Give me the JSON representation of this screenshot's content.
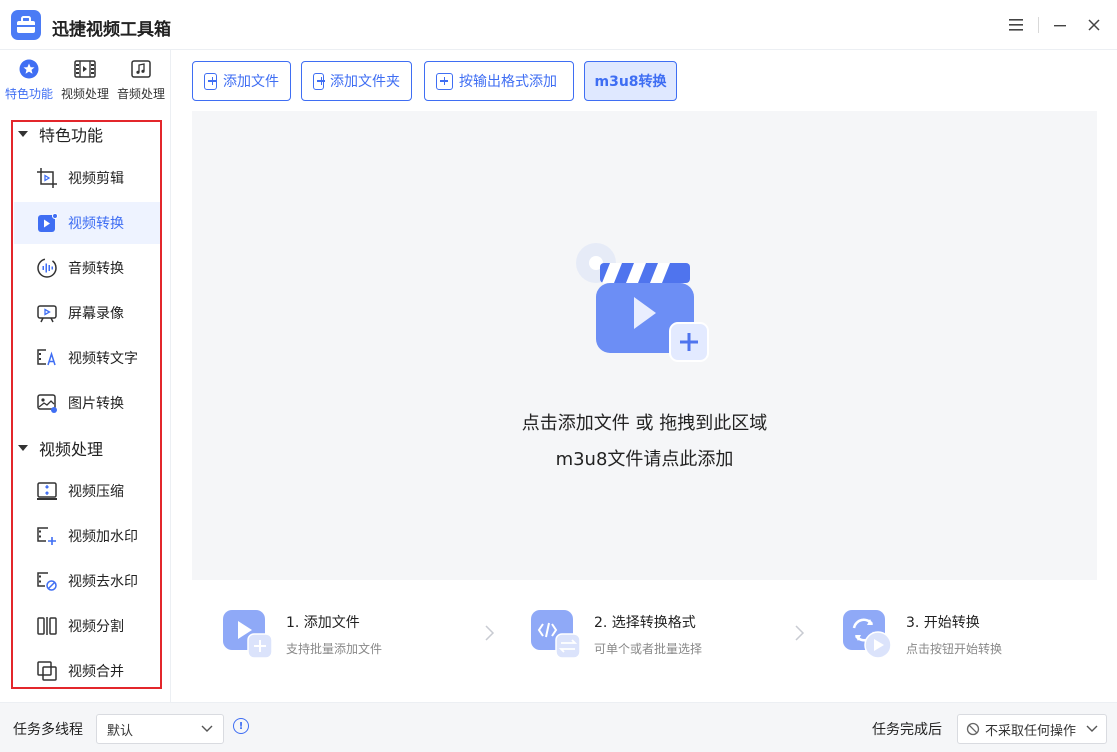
{
  "app": {
    "title": "迅捷视频工具箱"
  },
  "top_tabs": [
    {
      "label": "特色功能",
      "icon": "star-icon",
      "active": true
    },
    {
      "label": "视频处理",
      "icon": "film-icon",
      "active": false
    },
    {
      "label": "音频处理",
      "icon": "music-note-icon",
      "active": false
    }
  ],
  "sidebar": {
    "groups": [
      {
        "label": "特色功能",
        "items": [
          {
            "label": "视频剪辑",
            "icon": "crop-icon"
          },
          {
            "label": "视频转换",
            "icon": "video-convert-icon",
            "active": true
          },
          {
            "label": "音频转换",
            "icon": "audio-wave-icon"
          },
          {
            "label": "屏幕录像",
            "icon": "screen-record-icon"
          },
          {
            "label": "视频转文字",
            "icon": "video-to-text-icon"
          },
          {
            "label": "图片转换",
            "icon": "image-convert-icon"
          }
        ]
      },
      {
        "label": "视频处理",
        "items": [
          {
            "label": "视频压缩",
            "icon": "compress-icon"
          },
          {
            "label": "视频加水印",
            "icon": "add-watermark-icon"
          },
          {
            "label": "视频去水印",
            "icon": "remove-watermark-icon"
          },
          {
            "label": "视频分割",
            "icon": "split-icon"
          },
          {
            "label": "视频合并",
            "icon": "merge-icon"
          }
        ]
      }
    ]
  },
  "toolbar": {
    "add_file": "添加文件",
    "add_folder": "添加文件夹",
    "add_by_format": "按输出格式添加",
    "m3u8": "m3u8转换"
  },
  "dropzone": {
    "line1": "点击添加文件 或 拖拽到此区域",
    "line2": "m3u8文件请点此添加"
  },
  "steps": [
    {
      "title": "1. 添加文件",
      "desc": "支持批量添加文件"
    },
    {
      "title": "2. 选择转换格式",
      "desc": "可单个或者批量选择"
    },
    {
      "title": "3. 开始转换",
      "desc": "点击按钮开始转换"
    }
  ],
  "bottom": {
    "threads_label": "任务多线程",
    "threads_value": "默认",
    "after_label": "任务完成后",
    "after_value": "不采取任何操作"
  },
  "colors": {
    "accent": "#3f6ef3",
    "highlight_box": "#e3262b",
    "active_bg": "#eef3ff"
  }
}
